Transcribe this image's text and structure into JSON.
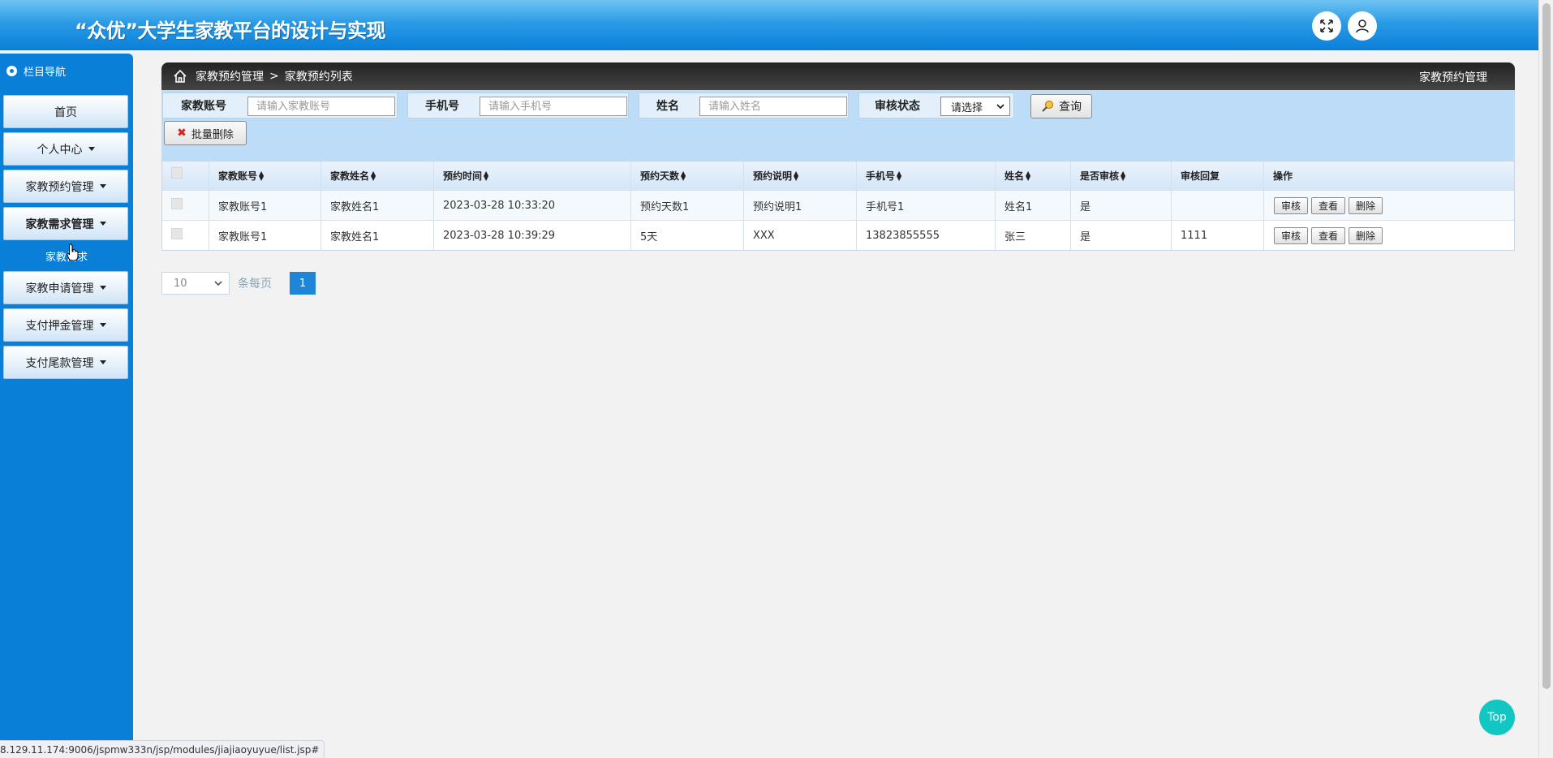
{
  "header": {
    "title": "“众优”大学生家教平台的设计与实现",
    "fullscreen_icon": "fullscreen-icon",
    "user_icon": "user-icon"
  },
  "sidebar": {
    "heading": "栏目导航",
    "items": [
      {
        "label": "首页",
        "has_caret": false
      },
      {
        "label": "个人中心",
        "has_caret": true
      },
      {
        "label": "家教预约管理",
        "has_caret": true
      },
      {
        "label": "家教需求管理",
        "has_caret": true
      },
      {
        "label": "家教申请管理",
        "has_caret": true
      },
      {
        "label": "支付押金管理",
        "has_caret": true
      },
      {
        "label": "支付尾款管理",
        "has_caret": true
      }
    ],
    "submenu_label": "家教需求"
  },
  "breadcrumb": {
    "home_icon": "home-icon",
    "parent": "家教预约管理",
    "separator": ">",
    "current": "家教预约列表",
    "right_title": "家教预约管理"
  },
  "search": {
    "fields": [
      {
        "label": "家教账号",
        "placeholder": "请输入家教账号"
      },
      {
        "label": "手机号",
        "placeholder": "请输入手机号"
      },
      {
        "label": "姓名",
        "placeholder": "请输入姓名"
      }
    ],
    "status_label": "审核状态",
    "status_value": "请选择",
    "query_button": "查询",
    "batch_delete_button": "批量删除"
  },
  "table": {
    "columns": [
      "",
      "家教账号",
      "家教姓名",
      "预约时间",
      "预约天数",
      "预约说明",
      "手机号",
      "姓名",
      "是否审核",
      "审核回复",
      "操作"
    ],
    "sortable": [
      false,
      true,
      true,
      true,
      true,
      true,
      true,
      true,
      true,
      false,
      false
    ],
    "rows": [
      {
        "account": "家教账号1",
        "name": "家教姓名1",
        "time": "2023-03-28 10:33:20",
        "days": "预约天数1",
        "note": "预约说明1",
        "phone": "手机号1",
        "person": "姓名1",
        "approved": "是",
        "reply": ""
      },
      {
        "account": "家教账号1",
        "name": "家教姓名1",
        "time": "2023-03-28 10:39:29",
        "days": "5天",
        "note": "XXX",
        "phone": "13823855555",
        "person": "张三",
        "approved": "是",
        "reply": "1111"
      }
    ],
    "actions": [
      "审核",
      "查看",
      "删除"
    ]
  },
  "pagination": {
    "page_size": "10",
    "per_page_label": "条每页",
    "current_page": "1"
  },
  "status_url": "8.129.11.174:9006/jspmw333n/jsp/modules/jiajiaoyuyue/list.jsp#",
  "top_button": "Top",
  "colors": {
    "sidebar": "#0a7fd8",
    "header": "#2a9be6",
    "crumb_bar": "#333333",
    "search_bg": "#bcdcf7",
    "page_active": "#1e86d8",
    "top_button": "#12c7c2"
  }
}
